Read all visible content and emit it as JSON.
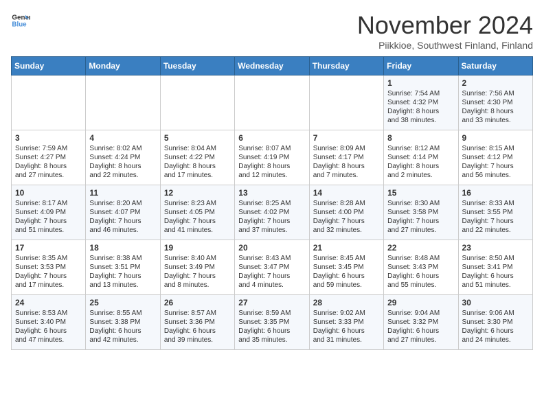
{
  "logo": {
    "line1": "General",
    "line2": "Blue"
  },
  "title": "November 2024",
  "subtitle": "Piikkioe, Southwest Finland, Finland",
  "days_of_week": [
    "Sunday",
    "Monday",
    "Tuesday",
    "Wednesday",
    "Thursday",
    "Friday",
    "Saturday"
  ],
  "weeks": [
    [
      {
        "day": "",
        "info": ""
      },
      {
        "day": "",
        "info": ""
      },
      {
        "day": "",
        "info": ""
      },
      {
        "day": "",
        "info": ""
      },
      {
        "day": "",
        "info": ""
      },
      {
        "day": "1",
        "info": "Sunrise: 7:54 AM\nSunset: 4:32 PM\nDaylight: 8 hours\nand 38 minutes."
      },
      {
        "day": "2",
        "info": "Sunrise: 7:56 AM\nSunset: 4:30 PM\nDaylight: 8 hours\nand 33 minutes."
      }
    ],
    [
      {
        "day": "3",
        "info": "Sunrise: 7:59 AM\nSunset: 4:27 PM\nDaylight: 8 hours\nand 27 minutes."
      },
      {
        "day": "4",
        "info": "Sunrise: 8:02 AM\nSunset: 4:24 PM\nDaylight: 8 hours\nand 22 minutes."
      },
      {
        "day": "5",
        "info": "Sunrise: 8:04 AM\nSunset: 4:22 PM\nDaylight: 8 hours\nand 17 minutes."
      },
      {
        "day": "6",
        "info": "Sunrise: 8:07 AM\nSunset: 4:19 PM\nDaylight: 8 hours\nand 12 minutes."
      },
      {
        "day": "7",
        "info": "Sunrise: 8:09 AM\nSunset: 4:17 PM\nDaylight: 8 hours\nand 7 minutes."
      },
      {
        "day": "8",
        "info": "Sunrise: 8:12 AM\nSunset: 4:14 PM\nDaylight: 8 hours\nand 2 minutes."
      },
      {
        "day": "9",
        "info": "Sunrise: 8:15 AM\nSunset: 4:12 PM\nDaylight: 7 hours\nand 56 minutes."
      }
    ],
    [
      {
        "day": "10",
        "info": "Sunrise: 8:17 AM\nSunset: 4:09 PM\nDaylight: 7 hours\nand 51 minutes."
      },
      {
        "day": "11",
        "info": "Sunrise: 8:20 AM\nSunset: 4:07 PM\nDaylight: 7 hours\nand 46 minutes."
      },
      {
        "day": "12",
        "info": "Sunrise: 8:23 AM\nSunset: 4:05 PM\nDaylight: 7 hours\nand 41 minutes."
      },
      {
        "day": "13",
        "info": "Sunrise: 8:25 AM\nSunset: 4:02 PM\nDaylight: 7 hours\nand 37 minutes."
      },
      {
        "day": "14",
        "info": "Sunrise: 8:28 AM\nSunset: 4:00 PM\nDaylight: 7 hours\nand 32 minutes."
      },
      {
        "day": "15",
        "info": "Sunrise: 8:30 AM\nSunset: 3:58 PM\nDaylight: 7 hours\nand 27 minutes."
      },
      {
        "day": "16",
        "info": "Sunrise: 8:33 AM\nSunset: 3:55 PM\nDaylight: 7 hours\nand 22 minutes."
      }
    ],
    [
      {
        "day": "17",
        "info": "Sunrise: 8:35 AM\nSunset: 3:53 PM\nDaylight: 7 hours\nand 17 minutes."
      },
      {
        "day": "18",
        "info": "Sunrise: 8:38 AM\nSunset: 3:51 PM\nDaylight: 7 hours\nand 13 minutes."
      },
      {
        "day": "19",
        "info": "Sunrise: 8:40 AM\nSunset: 3:49 PM\nDaylight: 7 hours\nand 8 minutes."
      },
      {
        "day": "20",
        "info": "Sunrise: 8:43 AM\nSunset: 3:47 PM\nDaylight: 7 hours\nand 4 minutes."
      },
      {
        "day": "21",
        "info": "Sunrise: 8:45 AM\nSunset: 3:45 PM\nDaylight: 6 hours\nand 59 minutes."
      },
      {
        "day": "22",
        "info": "Sunrise: 8:48 AM\nSunset: 3:43 PM\nDaylight: 6 hours\nand 55 minutes."
      },
      {
        "day": "23",
        "info": "Sunrise: 8:50 AM\nSunset: 3:41 PM\nDaylight: 6 hours\nand 51 minutes."
      }
    ],
    [
      {
        "day": "24",
        "info": "Sunrise: 8:53 AM\nSunset: 3:40 PM\nDaylight: 6 hours\nand 47 minutes."
      },
      {
        "day": "25",
        "info": "Sunrise: 8:55 AM\nSunset: 3:38 PM\nDaylight: 6 hours\nand 42 minutes."
      },
      {
        "day": "26",
        "info": "Sunrise: 8:57 AM\nSunset: 3:36 PM\nDaylight: 6 hours\nand 39 minutes."
      },
      {
        "day": "27",
        "info": "Sunrise: 8:59 AM\nSunset: 3:35 PM\nDaylight: 6 hours\nand 35 minutes."
      },
      {
        "day": "28",
        "info": "Sunrise: 9:02 AM\nSunset: 3:33 PM\nDaylight: 6 hours\nand 31 minutes."
      },
      {
        "day": "29",
        "info": "Sunrise: 9:04 AM\nSunset: 3:32 PM\nDaylight: 6 hours\nand 27 minutes."
      },
      {
        "day": "30",
        "info": "Sunrise: 9:06 AM\nSunset: 3:30 PM\nDaylight: 6 hours\nand 24 minutes."
      }
    ]
  ]
}
